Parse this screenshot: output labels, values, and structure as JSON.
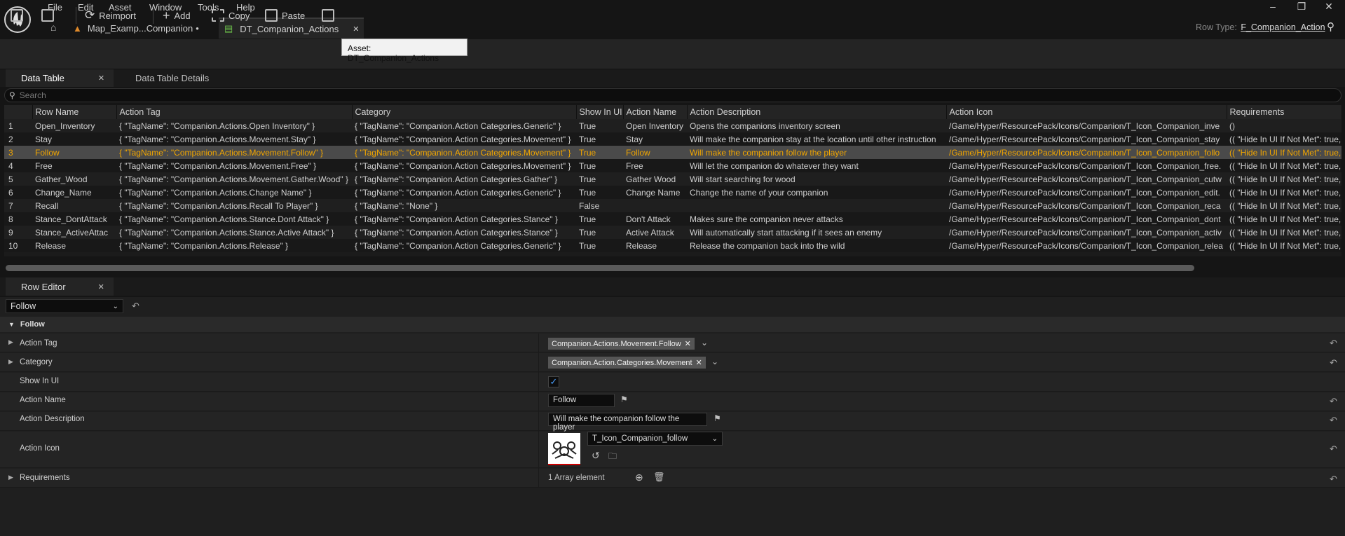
{
  "menu": [
    "File",
    "Edit",
    "Asset",
    "Window",
    "Tools",
    "Help"
  ],
  "tabs": {
    "map": "Map_Examp...Companion",
    "table": "DT_Companion_Actions"
  },
  "row_type": {
    "label": "Row Type:",
    "value": "F_Companion_Action"
  },
  "tooltip": "Asset: DT_Companion_Actions",
  "toolbar": {
    "reimport": "Reimport",
    "add": "Add",
    "copy": "Copy",
    "paste": "Paste"
  },
  "panel_tabs": {
    "data_table": "Data Table",
    "details": "Data Table Details"
  },
  "search": {
    "placeholder": "Search"
  },
  "columns": [
    "Row Name",
    "Action Tag",
    "Category",
    "Show In UI",
    "Action Name",
    "Action Description",
    "Action Icon",
    "Requirements"
  ],
  "rows": [
    [
      "1",
      "Open_Inventory",
      "{ \"TagName\": \"Companion.Actions.Open Inventory\" }",
      "{ \"TagName\": \"Companion.Action Categories.Generic\" }",
      "True",
      "Open Inventory",
      "Opens the companions inventory screen",
      "/Game/Hyper/ResourcePack/Icons/Companion/T_Icon_Companion_inve",
      "()"
    ],
    [
      "2",
      "Stay",
      "{ \"TagName\": \"Companion.Actions.Movement.Stay\" }",
      "{ \"TagName\": \"Companion.Action Categories.Movement\" }",
      "True",
      "Stay",
      "Will make the companion stay at the location until other instruction",
      "/Game/Hyper/ResourcePack/Icons/Companion/T_Icon_Companion_stay",
      "(( \"Hide In UI If Not Met\": true,"
    ],
    [
      "3",
      "Follow",
      "{ \"TagName\": \"Companion.Actions.Movement.Follow\" }",
      "{ \"TagName\": \"Companion.Action Categories.Movement\" }",
      "True",
      "Follow",
      "Will make the companion follow the player",
      "/Game/Hyper/ResourcePack/Icons/Companion/T_Icon_Companion_follo",
      "(( \"Hide In UI If Not Met\": true,"
    ],
    [
      "4",
      "Free",
      "{ \"TagName\": \"Companion.Actions.Movement.Free\" }",
      "{ \"TagName\": \"Companion.Action Categories.Movement\" }",
      "True",
      "Free",
      "Will let the companion do whatever they want",
      "/Game/Hyper/ResourcePack/Icons/Companion/T_Icon_Companion_free.",
      "(( \"Hide In UI If Not Met\": true,"
    ],
    [
      "5",
      "Gather_Wood",
      "{ \"TagName\": \"Companion.Actions.Movement.Gather.Wood\" }",
      "{ \"TagName\": \"Companion.Action Categories.Gather\" }",
      "True",
      "Gather Wood",
      "Will start searching for wood",
      "/Game/Hyper/ResourcePack/Icons/Companion/T_Icon_Companion_cutw",
      "(( \"Hide In UI If Not Met\": true,"
    ],
    [
      "6",
      "Change_Name",
      "{ \"TagName\": \"Companion.Actions.Change Name\" }",
      "{ \"TagName\": \"Companion.Action Categories.Generic\" }",
      "True",
      "Change Name",
      "Change the name of your companion",
      "/Game/Hyper/ResourcePack/Icons/Companion/T_Icon_Companion_edit.",
      "(( \"Hide In UI If Not Met\": true,"
    ],
    [
      "7",
      "Recall",
      "{ \"TagName\": \"Companion.Actions.Recall To Player\" }",
      "{ \"TagName\": \"None\" }",
      "False",
      "",
      "",
      "/Game/Hyper/ResourcePack/Icons/Companion/T_Icon_Companion_reca",
      "(( \"Hide In UI If Not Met\": true,"
    ],
    [
      "8",
      "Stance_DontAttack",
      "{ \"TagName\": \"Companion.Actions.Stance.Dont Attack\" }",
      "{ \"TagName\": \"Companion.Action Categories.Stance\" }",
      "True",
      "Don't Attack",
      "Makes sure the companion never attacks",
      "/Game/Hyper/ResourcePack/Icons/Companion/T_Icon_Companion_dont",
      "(( \"Hide In UI If Not Met\": true,"
    ],
    [
      "9",
      "Stance_ActiveAttac",
      "{ \"TagName\": \"Companion.Actions.Stance.Active Attack\" }",
      "{ \"TagName\": \"Companion.Action Categories.Stance\" }",
      "True",
      "Active Attack",
      "Will automatically start attacking if it sees an enemy",
      "/Game/Hyper/ResourcePack/Icons/Companion/T_Icon_Companion_activ",
      "(( \"Hide In UI If Not Met\": true,"
    ],
    [
      "10",
      "Release",
      "{ \"TagName\": \"Companion.Actions.Release\" }",
      "{ \"TagName\": \"Companion.Action Categories.Generic\" }",
      "True",
      "Release",
      "Release the companion back into the wild",
      "/Game/Hyper/ResourcePack/Icons/Companion/T_Icon_Companion_relea",
      "(( \"Hide In UI If Not Met\": true,"
    ]
  ],
  "selected_row": "3",
  "row_editor": {
    "tab": "Row Editor",
    "row": "Follow",
    "section": "Follow",
    "labels": {
      "action_tag": "Action Tag",
      "category": "Category",
      "show_in_ui": "Show In UI",
      "action_name": "Action Name",
      "action_description": "Action Description",
      "action_icon": "Action Icon",
      "requirements": "Requirements"
    },
    "values": {
      "action_tag": "Companion.Actions.Movement.Follow",
      "category": "Companion.Action.Categories.Movement",
      "show_in_ui": true,
      "action_name": "Follow",
      "action_description": "Will make the companion follow the player",
      "action_icon": "T_Icon_Companion_follow",
      "requirements": "1 Array element"
    }
  },
  "colors": {
    "accent": "#f0a500",
    "selection": "#4a4a4a",
    "background": "#151515"
  }
}
